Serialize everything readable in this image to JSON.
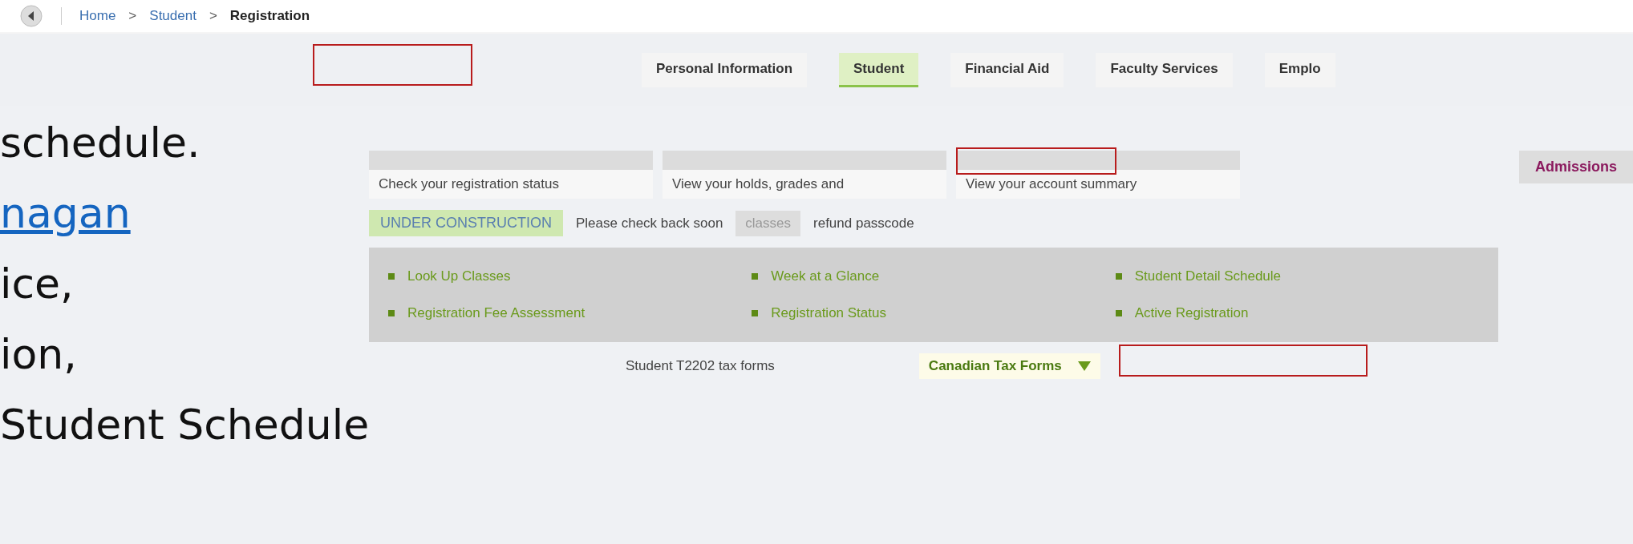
{
  "breadcrumb": [
    {
      "label": "Home",
      "current": false
    },
    {
      "separator": ">"
    },
    {
      "label": "Student",
      "current": false
    },
    {
      "separator": ">"
    },
    {
      "label": "Registration",
      "current": true
    }
  ],
  "tabs": [
    {
      "label": "Personal Information",
      "selected": false
    },
    {
      "label": "Student",
      "selected": true
    },
    {
      "label": "Financial Aid",
      "selected": false
    },
    {
      "label": "Faculty Services",
      "selected": false
    },
    {
      "label": "Emplo",
      "selected": false
    }
  ],
  "side_text": [
    {
      "text": "schedule.",
      "kind": "plain"
    },
    {
      "text": "nagan",
      "kind": "link"
    },
    {
      "text": "ice,",
      "kind": "plain"
    },
    {
      "text": "ion,",
      "kind": "plain"
    },
    {
      "text": "Student Schedule",
      "kind": "plain"
    }
  ],
  "cards": [
    {
      "text": "Check your registration status"
    },
    {
      "text": "View your holds, grades and"
    },
    {
      "text": "View your account summary"
    }
  ],
  "admissions": "Admissions",
  "notice": {
    "title": "UNDER CONSTRUCTION",
    "body": "Please check back soon",
    "aside": "classes",
    "passcode": "refund passcode"
  },
  "links": [
    "Look Up Classes",
    "Week at a Glance",
    "Student Detail Schedule",
    "Registration Fee Assessment",
    "Registration Status",
    "Active Registration"
  ],
  "tax": {
    "title": "Canadian Tax Forms",
    "item": "Student T2202 tax forms"
  }
}
